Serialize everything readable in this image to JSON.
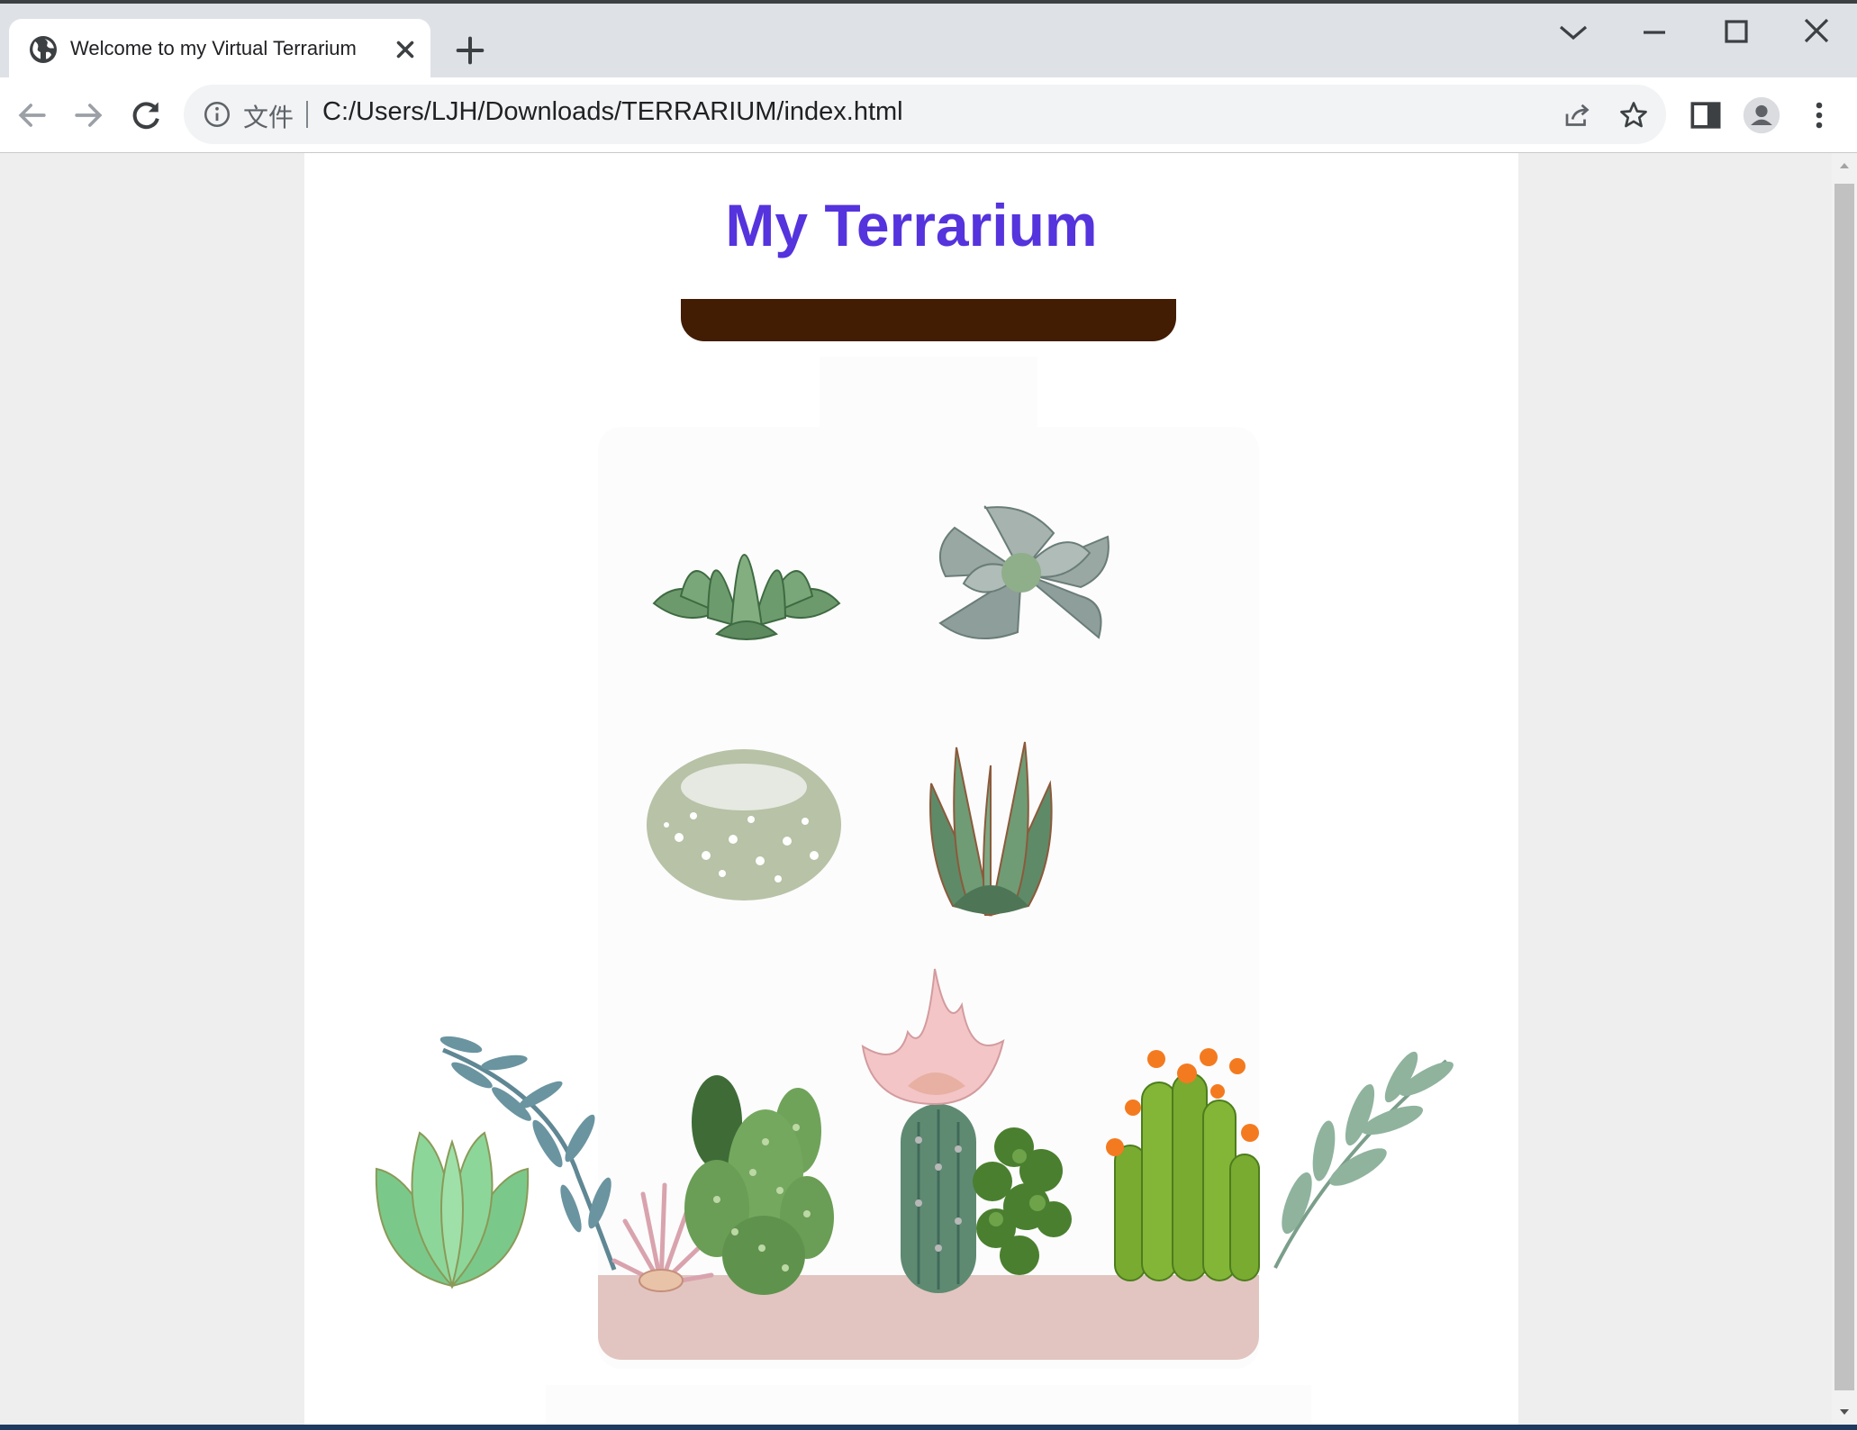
{
  "browser": {
    "tab": {
      "title": "Welcome to my Virtual Terrarium"
    },
    "address_bar": {
      "scheme_label": "文件",
      "url": "C:/Users/LJH/Downloads/TERRARIUM/index.html"
    }
  },
  "page": {
    "title": "My Terrarium",
    "colors": {
      "title": "#5533dd",
      "jar_lid": "#421c03",
      "dirt": "#e2c5c0",
      "jar_glass": "#fcfcfc",
      "page_background": "#eeeeee"
    },
    "plants": [
      {
        "name": "plant1",
        "kind": "green rosette succulent"
      },
      {
        "name": "plant2",
        "kind": "grey echeveria"
      },
      {
        "name": "plant3",
        "kind": "round spiny cactus"
      },
      {
        "name": "plant4",
        "kind": "agave"
      },
      {
        "name": "plant5",
        "kind": "jade rosette"
      },
      {
        "name": "plant6",
        "kind": "eucalyptus branch"
      },
      {
        "name": "plant7",
        "kind": "pink air plant"
      },
      {
        "name": "plant8",
        "kind": "prickly pear cactus"
      },
      {
        "name": "plant9",
        "kind": "pink flowering cactus"
      },
      {
        "name": "plant10",
        "kind": "fern"
      },
      {
        "name": "plant11",
        "kind": "orange flowering cactus"
      },
      {
        "name": "plant12",
        "kind": "leafy branch"
      }
    ]
  }
}
